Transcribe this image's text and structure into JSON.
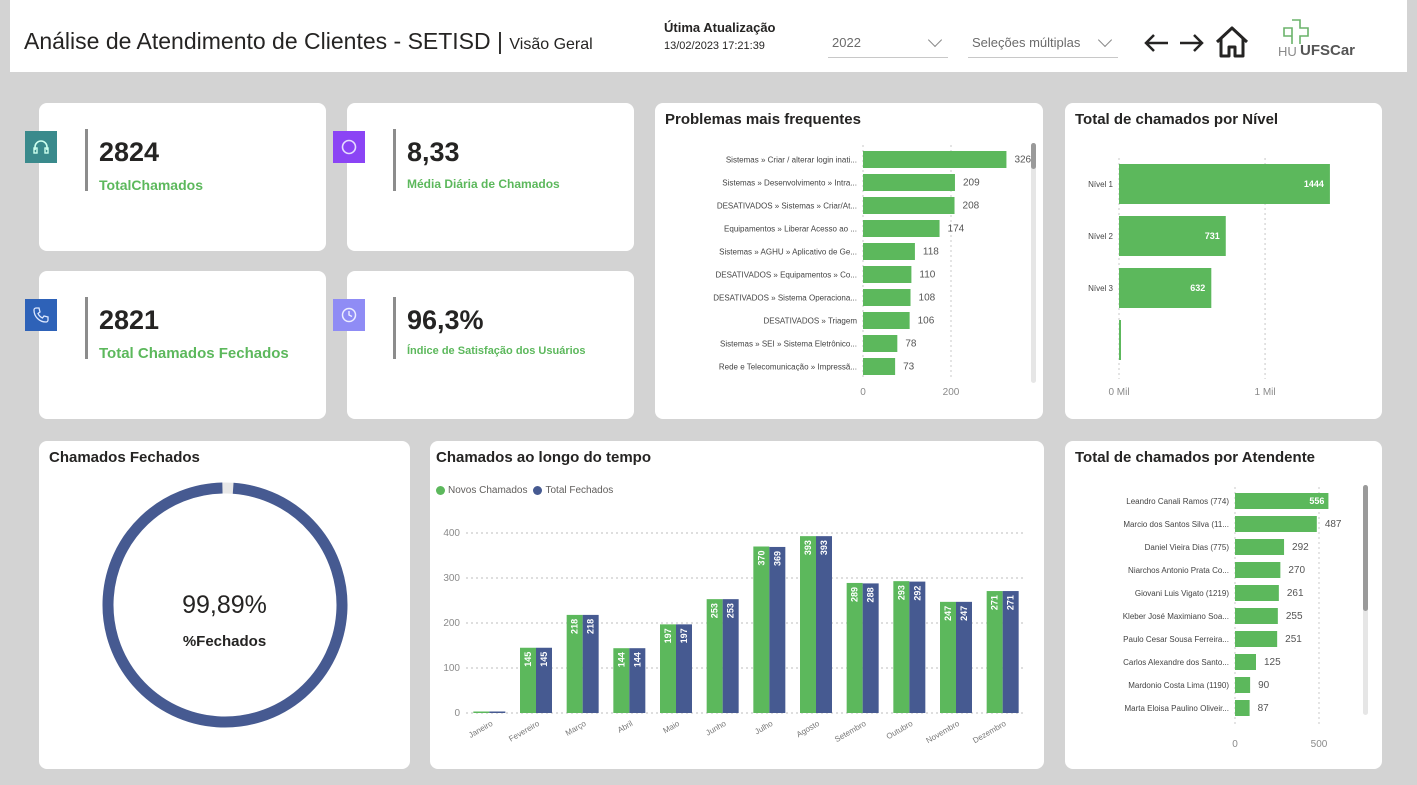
{
  "header": {
    "title": "Análise de Atendimento de Clientes - SETISD",
    "separator": "|",
    "subtitle": "Visão Geral",
    "update_label": "Útima Atualização",
    "update_value": "13/02/2023 17:21:39",
    "year_slicer": "2022",
    "multi_slicer": "Seleções múltiplas",
    "logo_prefix": "HU",
    "logo_text": "UFSCar"
  },
  "colors": {
    "green": "#5cb85c",
    "navy": "#465a91",
    "teal": "#3a8a8c",
    "purple": "#8b44f5",
    "blue": "#2e62b8",
    "lavender": "#8f8cf5"
  },
  "kpis": [
    {
      "value": "2824",
      "label": "TotalChamados",
      "icon": "headset-icon"
    },
    {
      "value": "8,33",
      "label": "Média Diária de Chamados",
      "icon": "circle-icon"
    },
    {
      "value": "2821",
      "label": "Total Chamados Fechados",
      "icon": "phone-icon"
    },
    {
      "value": "96,3%",
      "label": "Índice de Satisfação dos Usuários",
      "icon": "clock-icon"
    }
  ],
  "donut": {
    "title": "Chamados Fechados",
    "value": "99,89%",
    "label": "%Fechados",
    "fraction": 0.9989
  },
  "chart_data": [
    {
      "type": "bar",
      "title": "Problemas mais frequentes",
      "orientation": "horizontal",
      "categories": [
        "Sistemas » Criar / alterar login inati...",
        "Sistemas » Desenvolvimento » Intra...",
        "DESATIVADOS » Sistemas » Criar/At...",
        "Equipamentos » Liberar Acesso ao ...",
        "Sistemas » AGHU » Aplicativo de Ge...",
        "DESATIVADOS » Equipamentos » Co...",
        "DESATIVADOS » Sistema Operaciona...",
        "DESATIVADOS » Triagem",
        "Sistemas » SEI » Sistema Eletrônico...",
        "Rede e Telecomunicação » Impressã..."
      ],
      "values": [
        326,
        209,
        208,
        174,
        118,
        110,
        108,
        106,
        78,
        73
      ],
      "xticks": [
        "0",
        "200"
      ],
      "xlim": [
        0,
        350
      ]
    },
    {
      "type": "bar",
      "title": "Total de chamados por Nível",
      "orientation": "horizontal",
      "categories": [
        "Nível 1",
        "Nível 2",
        "Nível 3",
        ""
      ],
      "values": [
        1444,
        731,
        632,
        0
      ],
      "xticks": [
        "0 Mil",
        "1 Mil"
      ],
      "xlim": [
        0,
        1650
      ]
    },
    {
      "type": "bar",
      "title": "Chamados ao longo do tempo",
      "categories": [
        "Janeiro",
        "Fevereiro",
        "Março",
        "Abril",
        "Maio",
        "Junho",
        "Julho",
        "Agosto",
        "Setembro",
        "Outubro",
        "Novembro",
        "Dezembro"
      ],
      "series": [
        {
          "name": "Novos Chamados",
          "values": [
            2,
            145,
            218,
            144,
            197,
            253,
            370,
            393,
            289,
            293,
            247,
            271
          ]
        },
        {
          "name": "Total Fechados",
          "values": [
            2,
            145,
            218,
            144,
            197,
            253,
            369,
            393,
            288,
            292,
            247,
            271
          ]
        }
      ],
      "data_labels": [
        [
          "",
          "145",
          "218",
          "144",
          "197",
          "253",
          "370",
          "393",
          "289",
          "293",
          "247",
          "271"
        ],
        [
          "",
          "145",
          "218",
          "144",
          "197",
          "253",
          "369",
          "393",
          "288",
          "292",
          "247",
          "271"
        ]
      ],
      "yticks": [
        "0",
        "100",
        "200",
        "300",
        "400"
      ],
      "ylim": [
        0,
        420
      ],
      "grid": true,
      "legend": "top-left"
    },
    {
      "type": "bar",
      "title": "Total de chamados por Atendente",
      "orientation": "horizontal",
      "categories": [
        "Leandro Canali Ramos (774)",
        "Marcio dos Santos Silva (11...",
        "Daniel Vieira Dias (775)",
        "Niarchos Antonio Prata Co...",
        "Giovani Luis Vigato (1219)",
        "Kleber José Maximiano Soa...",
        "Paulo Cesar Sousa Ferreira...",
        "Carlos Alexandre dos Santo...",
        "Mardonio Costa Lima (1190)",
        "Marta Eloisa Paulino Oliveir..."
      ],
      "values": [
        556,
        487,
        292,
        270,
        261,
        255,
        251,
        125,
        90,
        87
      ],
      "xticks": [
        "0",
        "500"
      ],
      "xlim": [
        0,
        560
      ]
    }
  ]
}
